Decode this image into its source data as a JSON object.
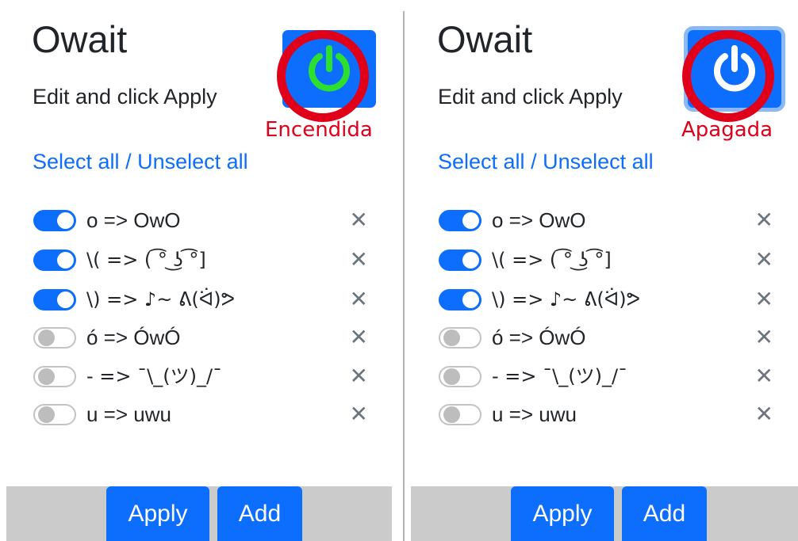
{
  "panels": [
    {
      "title": "Owait",
      "subtitle": "Edit and click Apply",
      "power_state": "on",
      "power_icon_color": "#2ee02e",
      "annotation": "Encendida",
      "select_all": "Select all",
      "separator": " / ",
      "unselect_all": "Unselect all",
      "rules": [
        {
          "enabled": true,
          "text": "o => OwO"
        },
        {
          "enabled": true,
          "text": "\\( => ( ͡° ͜ʖ ͡°]"
        },
        {
          "enabled": true,
          "text": "\\) => ♪~ ᕕ(ᐛ)ᕗ"
        },
        {
          "enabled": false,
          "text": "ó => ÓwÓ"
        },
        {
          "enabled": false,
          "text": "- => ¯\\_(ツ)_/¯"
        },
        {
          "enabled": false,
          "text": "u => uwu"
        }
      ],
      "delete_symbol": "✕",
      "apply_label": "Apply",
      "add_label": "Add"
    },
    {
      "title": "Owait",
      "subtitle": "Edit and click Apply",
      "power_state": "off",
      "power_icon_color": "#ffffff",
      "annotation": "Apagada",
      "select_all": "Select all",
      "separator": " / ",
      "unselect_all": "Unselect all",
      "rules": [
        {
          "enabled": true,
          "text": "o => OwO"
        },
        {
          "enabled": true,
          "text": "\\( => ( ͡° ͜ʖ ͡°]"
        },
        {
          "enabled": true,
          "text": "\\) => ♪~ ᕕ(ᐛ)ᕗ"
        },
        {
          "enabled": false,
          "text": "ó => ÓwÓ"
        },
        {
          "enabled": false,
          "text": "- => ¯\\_(ツ)_/¯"
        },
        {
          "enabled": false,
          "text": "u => uwu"
        }
      ],
      "delete_symbol": "✕",
      "apply_label": "Apply",
      "add_label": "Add"
    }
  ],
  "colors": {
    "accent": "#0d6efd",
    "annotation_red": "#e0001a",
    "footer_bg": "#cbcbcb"
  }
}
